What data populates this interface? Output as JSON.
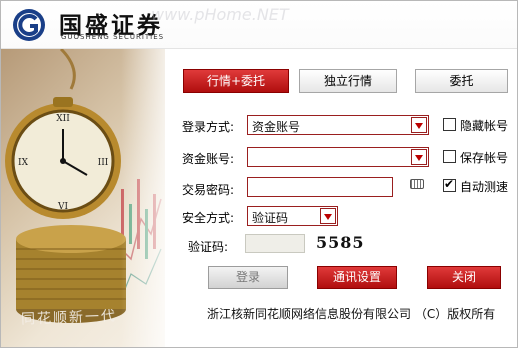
{
  "brand": {
    "name_cn": "国盛证券",
    "name_en": "GUOSHENG SECURITIES",
    "watermark": "www.pHome.NET",
    "slogan": "同花顺新一代"
  },
  "tabs": [
    {
      "label": "行情+委托",
      "active": true
    },
    {
      "label": "独立行情",
      "active": false
    },
    {
      "label": "委托",
      "active": false
    }
  ],
  "form": {
    "login_mode_label": "登录方式:",
    "login_mode_value": "资金账号",
    "account_label": "资金账号:",
    "account_value": "",
    "password_label": "交易密码:",
    "password_value": "",
    "security_label": "安全方式:",
    "security_value": "验证码",
    "verify_label": "验证码:",
    "verify_value": "",
    "captcha": "5585"
  },
  "options": {
    "hide_account": {
      "label": "隐藏帐号",
      "checked": false
    },
    "save_account": {
      "label": "保存帐号",
      "checked": false
    },
    "auto_speedtest": {
      "label": "自动测速",
      "checked": true
    }
  },
  "buttons": {
    "login": "登录",
    "comm_settings": "通讯设置",
    "close": "关闭"
  },
  "footer": "浙江核新同花顺网络信息股份有限公司 （C）版权所有",
  "colors": {
    "accent_red": "#c41010",
    "border_red": "#9a1f1f"
  }
}
